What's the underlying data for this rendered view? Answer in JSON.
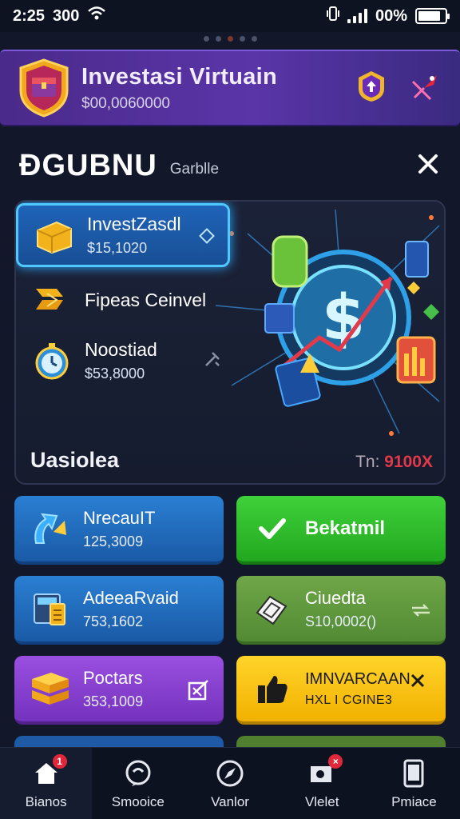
{
  "status_bar": {
    "time": "2:25",
    "extra": "300",
    "battery": "00%",
    "battery_level": 0.85
  },
  "header": {
    "title": "Investasi Virtuain",
    "subtitle": "$00,0060000",
    "logo_icon": "treasure-chest-icon",
    "actions": [
      {
        "icon": "shield-badge-icon"
      },
      {
        "icon": "rocket-icon"
      }
    ]
  },
  "section": {
    "title": "ÐGUBNU",
    "subtitle": "Garblle",
    "close_icon": "close-icon"
  },
  "panel": {
    "items": [
      {
        "title": "InvestZasdl",
        "value": "$15,1020",
        "icon": "gold-coins-icon",
        "active": true
      },
      {
        "title": "Fipeas Ceinvel",
        "value": "",
        "icon": "gold-arrows-icon",
        "active": false
      },
      {
        "title": "Noostiad",
        "value": "$53,8000",
        "icon": "stopwatch-icon",
        "active": false
      }
    ],
    "footer_left": "Uasiolea",
    "footer_right_prefix": "Tn:",
    "footer_right_value": "9100X"
  },
  "cards": [
    {
      "title": "NrecauIT",
      "value": "125,3009",
      "icon": "chart-arrow-icon",
      "color": "blue"
    },
    {
      "title": "Bekatmil",
      "value": "",
      "icon": "check-icon",
      "color": "green"
    },
    {
      "title": "AdeeaRvaid",
      "value": "753,1602",
      "icon": "calculator-icon",
      "color": "blue"
    },
    {
      "title": "Ciuedta",
      "value": "S10,0002()",
      "icon": "cash-icon",
      "color": "olive"
    },
    {
      "title": "Poctars",
      "value": "353,1009",
      "icon": "gold-stack-icon",
      "color": "purple"
    },
    {
      "title": "IMNVARCAAN",
      "value": "HXL I CGINE3",
      "icon": "thumbs-up-icon",
      "color": "yellow"
    }
  ],
  "nav": [
    {
      "label": "Bianos",
      "icon": "home-icon",
      "badge": "1",
      "active": true
    },
    {
      "label": "Smooice",
      "icon": "chat-icon",
      "badge": "",
      "active": false
    },
    {
      "label": "Vanlor",
      "icon": "compass-icon",
      "badge": "",
      "active": false
    },
    {
      "label": "Vlelet",
      "icon": "wallet-icon",
      "badge": "×",
      "active": false
    },
    {
      "label": "Pmiace",
      "icon": "phone-icon",
      "badge": "",
      "active": false
    }
  ]
}
